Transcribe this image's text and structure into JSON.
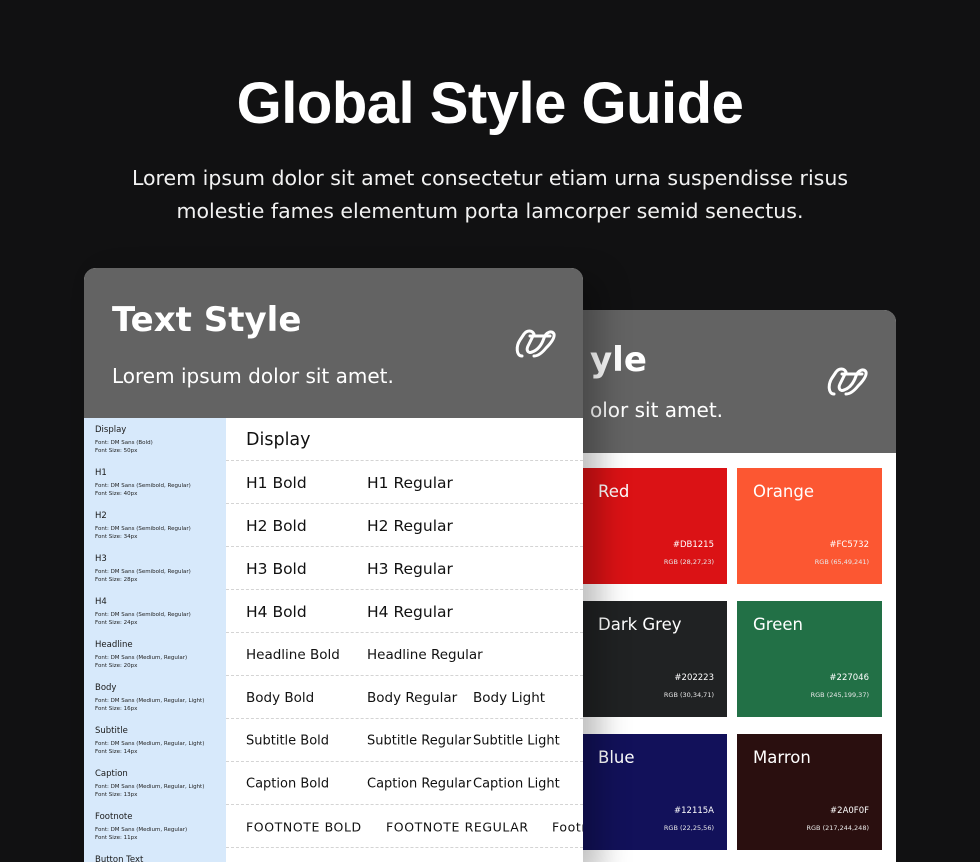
{
  "hero": {
    "title": "Global Style Guide",
    "subtitle": "Lorem ipsum dolor sit amet consectetur etiam urna suspendisse risus molestie fames elementum porta lamcorper semid senectus."
  },
  "text_card": {
    "title": "Text Style",
    "subtitle": "Lorem ipsum dolor sit amet.",
    "logo": "brand-logo-icon",
    "rows": [
      {
        "name": "Display",
        "font": "Font: DM Sans (Bold)",
        "size": "Font Size: 50px",
        "samples": [
          "Display"
        ]
      },
      {
        "name": "H1",
        "font": "Font: DM Sans (Semibold, Regular)",
        "size": "Font Size: 40px",
        "samples": [
          "H1 Bold",
          "H1 Regular"
        ]
      },
      {
        "name": "H2",
        "font": "Font: DM Sans (Semibold, Regular)",
        "size": "Font Size: 34px",
        "samples": [
          "H2 Bold",
          "H2 Regular"
        ]
      },
      {
        "name": "H3",
        "font": "Font: DM Sans (Semibold, Regular)",
        "size": "Font Size: 28px",
        "samples": [
          "H3 Bold",
          "H3 Regular"
        ]
      },
      {
        "name": "H4",
        "font": "Font: DM Sans (Semibold, Regular)",
        "size": "Font Size: 24px",
        "samples": [
          "H4 Bold",
          "H4 Regular"
        ]
      },
      {
        "name": "Headline",
        "font": "Font: DM Sans (Medium, Regular)",
        "size": "Font Size: 20px",
        "samples": [
          "Headline Bold",
          "Headline Regular"
        ]
      },
      {
        "name": "Body",
        "font": "Font: DM Sans (Medium, Regular, Light)",
        "size": "Font Size: 16px",
        "samples": [
          "Body Bold",
          "Body Regular",
          "Body Light"
        ]
      },
      {
        "name": "Subtitle",
        "font": "Font: DM Sans (Medium, Regular, Light)",
        "size": "Font Size: 14px",
        "samples": [
          "Subtitle Bold",
          "Subtitle Regular",
          "Subtitle Light"
        ]
      },
      {
        "name": "Caption",
        "font": "Font: DM Sans (Medium, Regular, Light)",
        "size": "Font Size: 13px",
        "samples": [
          "Caption Bold",
          "Caption Regular",
          "Caption Light"
        ]
      },
      {
        "name": "Footnote",
        "font": "Font: DM Sans (Medium, Regular)",
        "size": "Font Size: 11px",
        "samples": [
          "FOOTNOTE BOLD",
          "FOOTNOTE REGULAR",
          "Footr"
        ]
      },
      {
        "name": "Button Text",
        "font": "",
        "size": "",
        "samples": []
      }
    ]
  },
  "color_card": {
    "title_visible": "yle",
    "subtitle_visible": "olor sit amet.",
    "logo": "brand-logo-icon",
    "swatches": [
      {
        "name": "Red",
        "hex": "#DB1215",
        "rgb": "RGB (28,27,23)",
        "color": "#DB1215"
      },
      {
        "name": "Orange",
        "hex": "#FC5732",
        "rgb": "RGB (65,49,241)",
        "color": "#FC5732"
      },
      {
        "name": "Dark Grey",
        "hex": "#202223",
        "rgb": "RGB (30,34,71)",
        "color": "#202223"
      },
      {
        "name": "Green",
        "hex": "#227046",
        "rgb": "RGB (245,199,37)",
        "color": "#227046"
      },
      {
        "name": "Blue",
        "hex": "#12115A",
        "rgb": "RGB (22,25,56)",
        "color": "#12115A"
      },
      {
        "name": "Marron",
        "hex": "#2A0F0F",
        "rgb": "RGB (217,244,248)",
        "color": "#2A0F0F"
      }
    ]
  }
}
